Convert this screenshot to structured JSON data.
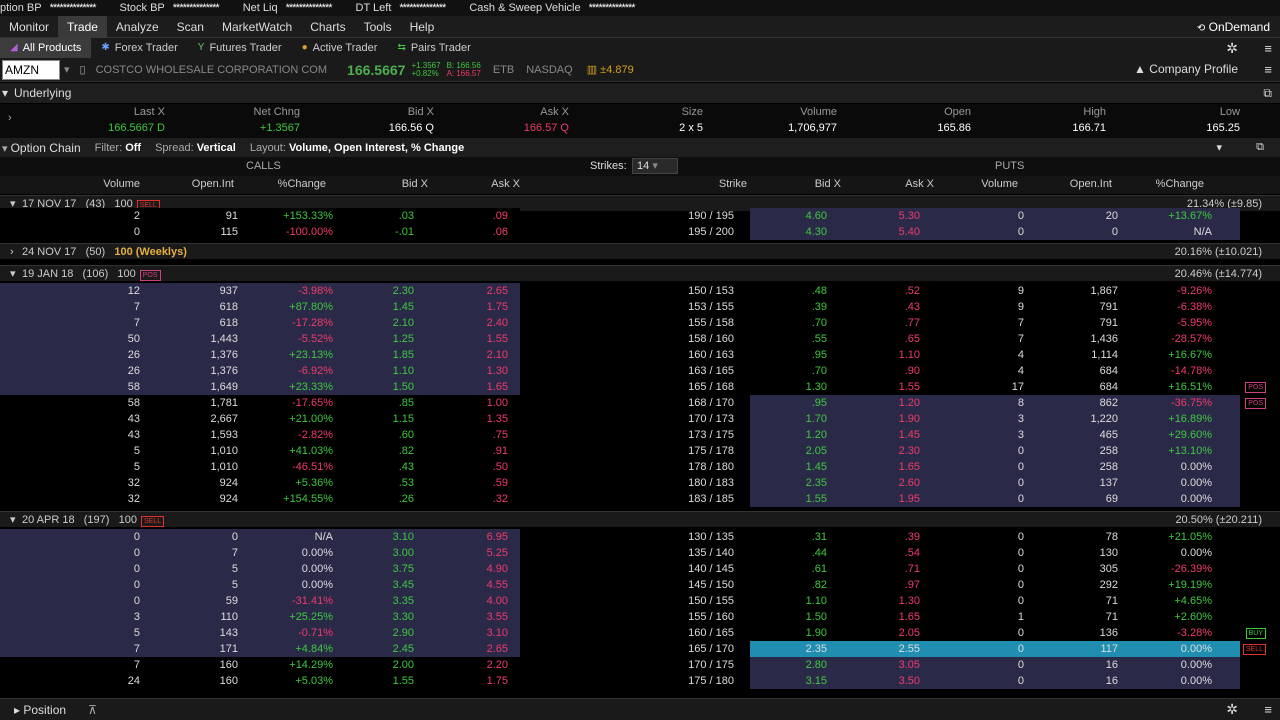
{
  "topbar": {
    "option_bp": "ption BP",
    "option_bp_val": "**************",
    "stock_bp": "Stock BP",
    "stock_bp_val": "**************",
    "net_liq": "Net Liq",
    "net_liq_val": "**************",
    "dt_left": "DT Left",
    "dt_left_val": "**************",
    "cash": "Cash & Sweep Vehicle",
    "cash_val": "**************"
  },
  "menu": [
    "Monitor",
    "Trade",
    "Analyze",
    "Scan",
    "MarketWatch",
    "Charts",
    "Tools",
    "Help"
  ],
  "ondemand": "OnDemand",
  "subtabs": [
    "All Products",
    "Forex Trader",
    "Futures Trader",
    "Active Trader",
    "Pairs Trader"
  ],
  "symbol": {
    "value": "AMZN",
    "desc": "COSTCO WHOLESALE CORPORATION COM",
    "last": "166.5667",
    "chg": "+1.3567",
    "pct": "+0.82%",
    "bid": "B: 166.56",
    "ask": "A: 166.57",
    "etb": "ETB",
    "exch": "NASDAQ",
    "move": "±4.879",
    "company_profile": "Company Profile"
  },
  "underlying": {
    "title": "Underlying",
    "headers": [
      "Last X",
      "Net Chng",
      "Bid X",
      "Ask X",
      "Size",
      "Volume",
      "Open",
      "High",
      "Low"
    ],
    "values": [
      "166.5667 D",
      "+1.3567",
      "166.56 Q",
      "166.57 Q",
      "2 x 5",
      "1,706,977",
      "165.86",
      "166.71",
      "165.25"
    ]
  },
  "option_chain": {
    "title": "Option Chain",
    "filter_label": "Filter:",
    "filter": "Off",
    "spread_label": "Spread:",
    "spread": "Vertical",
    "layout_label": "Layout:",
    "layout": "Volume, Open Interest, % Change",
    "calls": "CALLS",
    "puts": "PUTS",
    "strikes_label": "Strikes:",
    "strikes": "14"
  },
  "headers": {
    "call": [
      "Volume",
      "Open.Int",
      "%Change",
      "Bid X",
      "Ask X"
    ],
    "strike": "Strike",
    "put": [
      "Bid X",
      "Ask X",
      "Volume",
      "Open.Int",
      "%Change"
    ]
  },
  "groups": [
    {
      "exp": "17 NOV 17",
      "n": "(43)",
      "m": "100",
      "tag": "SELL",
      "iv": "21.34% (±9.85)"
    },
    {
      "exp": "24 NOV 17",
      "n": "(50)",
      "m": "100 (Weeklys)",
      "tag": "",
      "iv": "20.16% (±10.021)"
    },
    {
      "exp": "19 JAN 18",
      "n": "(106)",
      "m": "100",
      "tag": "POS",
      "iv": "20.46% (±14.774)"
    },
    {
      "exp": "20 APR 18",
      "n": "(197)",
      "m": "100",
      "tag": "SELL",
      "iv": "20.50% (±20.211)"
    }
  ],
  "rows_nov": [
    [
      "2",
      "91",
      "+153.33%",
      ".03",
      ".09",
      "190 / 195",
      "4.60",
      "5.30",
      "0",
      "20",
      "+13.67%"
    ],
    [
      "0",
      "115",
      "-100.00%",
      "-.01",
      ".06",
      "195 / 200",
      "4.30",
      "5.40",
      "0",
      "0",
      "N/A"
    ]
  ],
  "rows_jan": [
    [
      "12",
      "937",
      "-3.98%",
      "2.30",
      "2.65",
      "150 / 153",
      ".48",
      ".52",
      "9",
      "1,867",
      "-9.26%"
    ],
    [
      "7",
      "618",
      "+87.80%",
      "1.45",
      "1.75",
      "153 / 155",
      ".39",
      ".43",
      "9",
      "791",
      "-6.38%"
    ],
    [
      "7",
      "618",
      "-17.28%",
      "2.10",
      "2.40",
      "155 / 158",
      ".70",
      ".77",
      "7",
      "791",
      "-5.95%"
    ],
    [
      "50",
      "1,443",
      "-5.52%",
      "1.25",
      "1.55",
      "158 / 160",
      ".55",
      ".65",
      "7",
      "1,436",
      "-28.57%"
    ],
    [
      "26",
      "1,376",
      "+23.13%",
      "1.85",
      "2.10",
      "160 / 163",
      ".95",
      "1.10",
      "4",
      "1,114",
      "+16.67%"
    ],
    [
      "26",
      "1,376",
      "-6.92%",
      "1.10",
      "1.30",
      "163 / 165",
      ".70",
      ".90",
      "4",
      "684",
      "-14.78%"
    ],
    [
      "58",
      "1,649",
      "+23.33%",
      "1.50",
      "1.65",
      "165 / 168",
      "1.30",
      "1.55",
      "17",
      "684",
      "+16.51%"
    ],
    [
      "58",
      "1,781",
      "-17.65%",
      ".85",
      "1.00",
      "168 / 170",
      ".95",
      "1.20",
      "8",
      "862",
      "-36.75%"
    ],
    [
      "43",
      "2,667",
      "+21.00%",
      "1.15",
      "1.35",
      "170 / 173",
      "1.70",
      "1.90",
      "3",
      "1,220",
      "+16.89%"
    ],
    [
      "43",
      "1,593",
      "-2.82%",
      ".60",
      ".75",
      "173 / 175",
      "1.20",
      "1.45",
      "3",
      "465",
      "+29.60%"
    ],
    [
      "5",
      "1,010",
      "+41.03%",
      ".82",
      ".91",
      "175 / 178",
      "2.05",
      "2.30",
      "0",
      "258",
      "+13.10%"
    ],
    [
      "5",
      "1,010",
      "-46.51%",
      ".43",
      ".50",
      "178 / 180",
      "1.45",
      "1.65",
      "0",
      "258",
      "0.00%"
    ],
    [
      "32",
      "924",
      "+5.36%",
      ".53",
      ".59",
      "180 / 183",
      "2.35",
      "2.60",
      "0",
      "137",
      "0.00%"
    ],
    [
      "32",
      "924",
      "+154.55%",
      ".26",
      ".32",
      "183 / 185",
      "1.55",
      "1.95",
      "0",
      "69",
      "0.00%"
    ]
  ],
  "rows_apr": [
    [
      "0",
      "0",
      "N/A",
      "3.10",
      "6.95",
      "130 / 135",
      ".31",
      ".39",
      "0",
      "78",
      "+21.05%"
    ],
    [
      "0",
      "7",
      "0.00%",
      "3.00",
      "5.25",
      "135 / 140",
      ".44",
      ".54",
      "0",
      "130",
      "0.00%"
    ],
    [
      "0",
      "5",
      "0.00%",
      "3.75",
      "4.90",
      "140 / 145",
      ".61",
      ".71",
      "0",
      "305",
      "-26.39%"
    ],
    [
      "0",
      "5",
      "0.00%",
      "3.45",
      "4.55",
      "145 / 150",
      ".82",
      ".97",
      "0",
      "292",
      "+19.19%"
    ],
    [
      "0",
      "59",
      "-31.41%",
      "3.35",
      "4.00",
      "150 / 155",
      "1.10",
      "1.30",
      "0",
      "71",
      "+4.65%"
    ],
    [
      "3",
      "110",
      "+25.25%",
      "3.30",
      "3.55",
      "155 / 160",
      "1.50",
      "1.65",
      "1",
      "71",
      "+2.60%"
    ],
    [
      "5",
      "143",
      "-0.71%",
      "2.90",
      "3.10",
      "160 / 165",
      "1.90",
      "2.05",
      "0",
      "136",
      "-3.28%"
    ],
    [
      "7",
      "171",
      "+4.84%",
      "2.45",
      "2.65",
      "165 / 170",
      "2.35",
      "2.55",
      "0",
      "117",
      "0.00%"
    ],
    [
      "7",
      "160",
      "+14.29%",
      "2.00",
      "2.20",
      "170 / 175",
      "2.80",
      "3.05",
      "0",
      "16",
      "0.00%"
    ],
    [
      "24",
      "160",
      "+5.03%",
      "1.55",
      "1.75",
      "175 / 180",
      "3.15",
      "3.50",
      "0",
      "16",
      "0.00%"
    ]
  ],
  "row_tags": {
    "jan_6": "POS",
    "jan_7": "POS",
    "apr_6": "BUY",
    "apr_7": "SELL"
  },
  "bottom": {
    "position": "Position"
  },
  "colors": {
    "green": "#3ec83e",
    "red": "#f03a6a",
    "highlight": "#1f8eb0",
    "purple": "#2a2a48"
  }
}
